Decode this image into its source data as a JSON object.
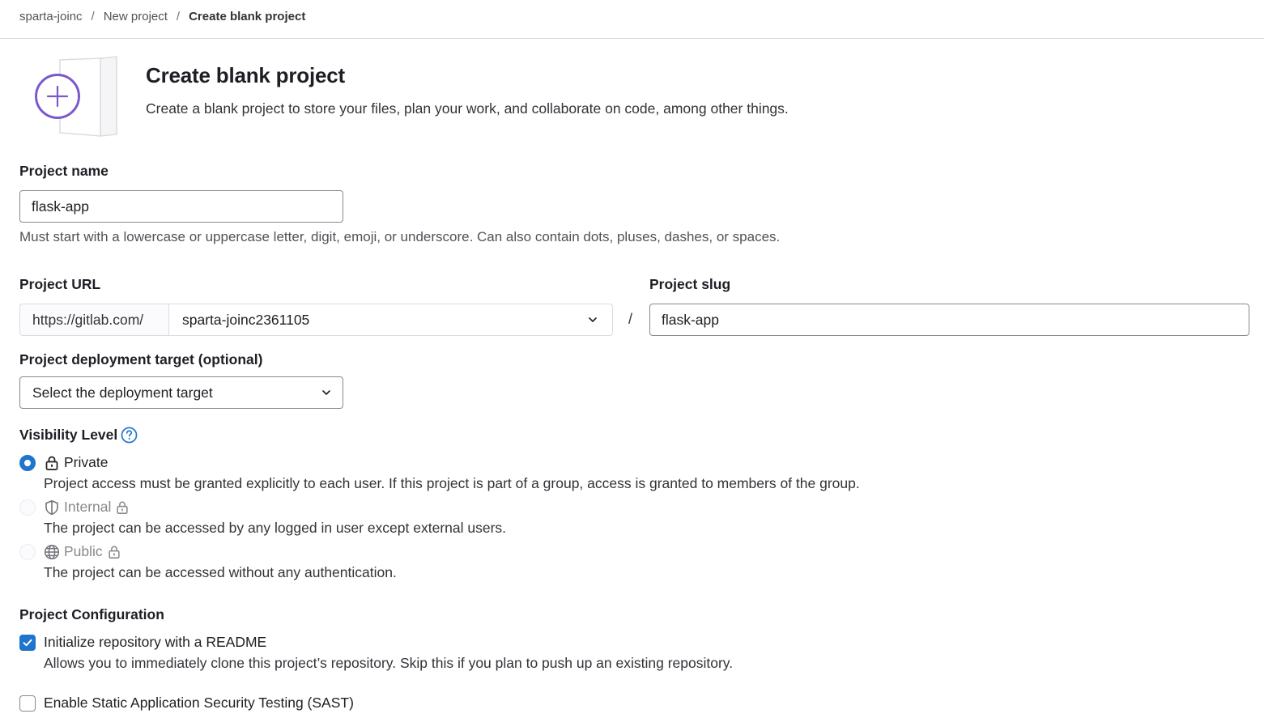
{
  "breadcrumb": {
    "items": [
      "sparta-joinc",
      "New project"
    ],
    "current": "Create blank project",
    "separator": "/"
  },
  "header": {
    "title": "Create blank project",
    "description": "Create a blank project to store your files, plan your work, and collaborate on code, among other things."
  },
  "project_name": {
    "label": "Project name",
    "value": "flask-app",
    "help": "Must start with a lowercase or uppercase letter, digit, emoji, or underscore. Can also contain dots, pluses, dashes, or spaces."
  },
  "project_url": {
    "label": "Project URL",
    "prefix": "https://gitlab.com/",
    "namespace": "sparta-joinc2361105",
    "separator": "/"
  },
  "project_slug": {
    "label": "Project slug",
    "value": "flask-app"
  },
  "deployment_target": {
    "label": "Project deployment target (optional)",
    "selected": "Select the deployment target"
  },
  "visibility": {
    "label": "Visibility Level",
    "options": [
      {
        "label": "Private",
        "description": "Project access must be granted explicitly to each user. If this project is part of a group, access is granted to members of the group.",
        "checked": true,
        "disabled": false,
        "icon": "lock-icon"
      },
      {
        "label": "Internal",
        "description": "The project can be accessed by any logged in user except external users.",
        "checked": false,
        "disabled": true,
        "icon": "shield-icon"
      },
      {
        "label": "Public",
        "description": "The project can be accessed without any authentication.",
        "checked": false,
        "disabled": true,
        "icon": "globe-icon"
      }
    ]
  },
  "configuration": {
    "label": "Project Configuration",
    "readme": {
      "label": "Initialize repository with a README",
      "description": "Allows you to immediately clone this project’s repository. Skip this if you plan to push up an existing repository.",
      "checked": true
    },
    "sast": {
      "label": "Enable Static Application Security Testing (SAST)",
      "checked": false
    }
  },
  "colors": {
    "accent": "#1f75cb",
    "illustration": "#7b58cf"
  }
}
